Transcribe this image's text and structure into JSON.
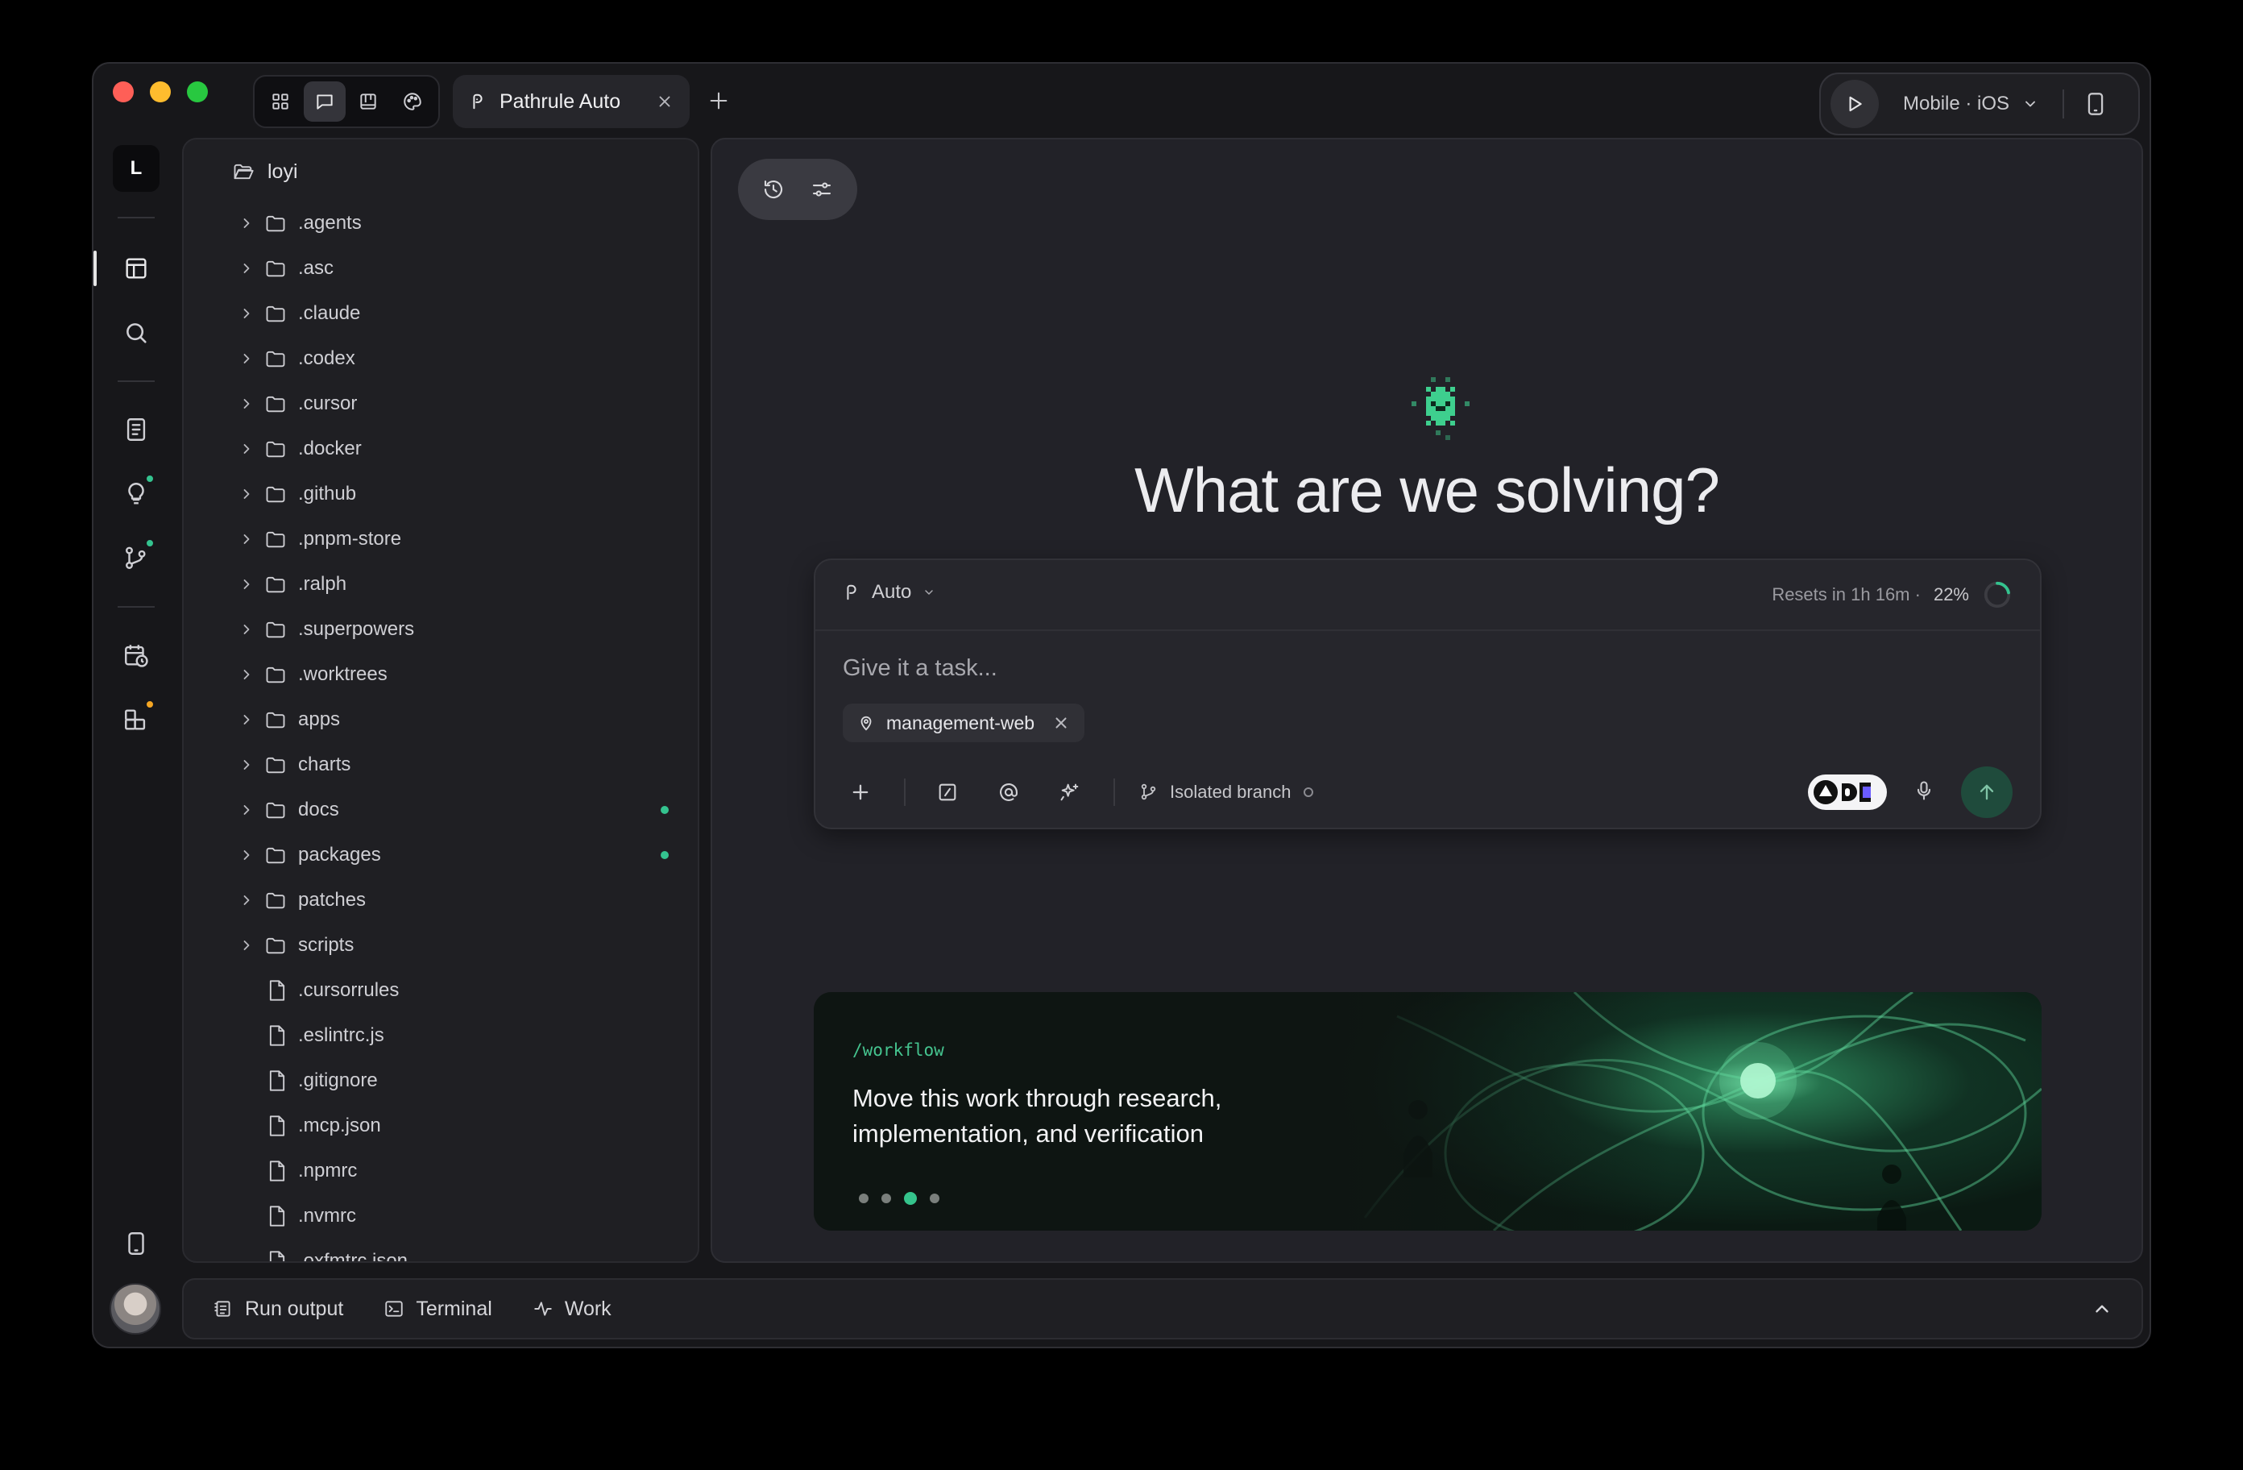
{
  "tab": {
    "title": "Pathrule Auto"
  },
  "runner": {
    "label": "Mobile · iOS"
  },
  "rail": {
    "avatar_letter": "L"
  },
  "tree": {
    "root": "loyi",
    "folders": [
      {
        "name": ".agents",
        "modified": false
      },
      {
        "name": ".asc",
        "modified": false
      },
      {
        "name": ".claude",
        "modified": false
      },
      {
        "name": ".codex",
        "modified": false
      },
      {
        "name": ".cursor",
        "modified": false
      },
      {
        "name": ".docker",
        "modified": false
      },
      {
        "name": ".github",
        "modified": false
      },
      {
        "name": ".pnpm-store",
        "modified": false
      },
      {
        "name": ".ralph",
        "modified": false
      },
      {
        "name": ".superpowers",
        "modified": false
      },
      {
        "name": ".worktrees",
        "modified": false
      },
      {
        "name": "apps",
        "modified": false
      },
      {
        "name": "charts",
        "modified": false
      },
      {
        "name": "docs",
        "modified": true
      },
      {
        "name": "packages",
        "modified": true
      },
      {
        "name": "patches",
        "modified": false
      },
      {
        "name": "scripts",
        "modified": false
      }
    ],
    "files": [
      ".cursorrules",
      ".eslintrc.js",
      ".gitignore",
      ".mcp.json",
      ".npmrc",
      ".nvmrc",
      ".oxfmtrc.json"
    ]
  },
  "main": {
    "headline": "What are we solving?",
    "composer": {
      "model": "Auto",
      "resets": "Resets in 1h 16m ·",
      "usage": "22%",
      "usage_fraction": 0.22,
      "placeholder": "Give it a task...",
      "chip": "management-web",
      "branch": "Isolated branch"
    },
    "card": {
      "command": "/workflow",
      "text": "Move this work through research, implementation, and verification",
      "active_dot": 2,
      "dot_count": 4
    }
  },
  "bottom": {
    "items": [
      "Run output",
      "Terminal",
      "Work"
    ]
  },
  "colors": {
    "accent": "#34c38f",
    "send": "#1f4b3c",
    "panel": "#1f1f23"
  }
}
